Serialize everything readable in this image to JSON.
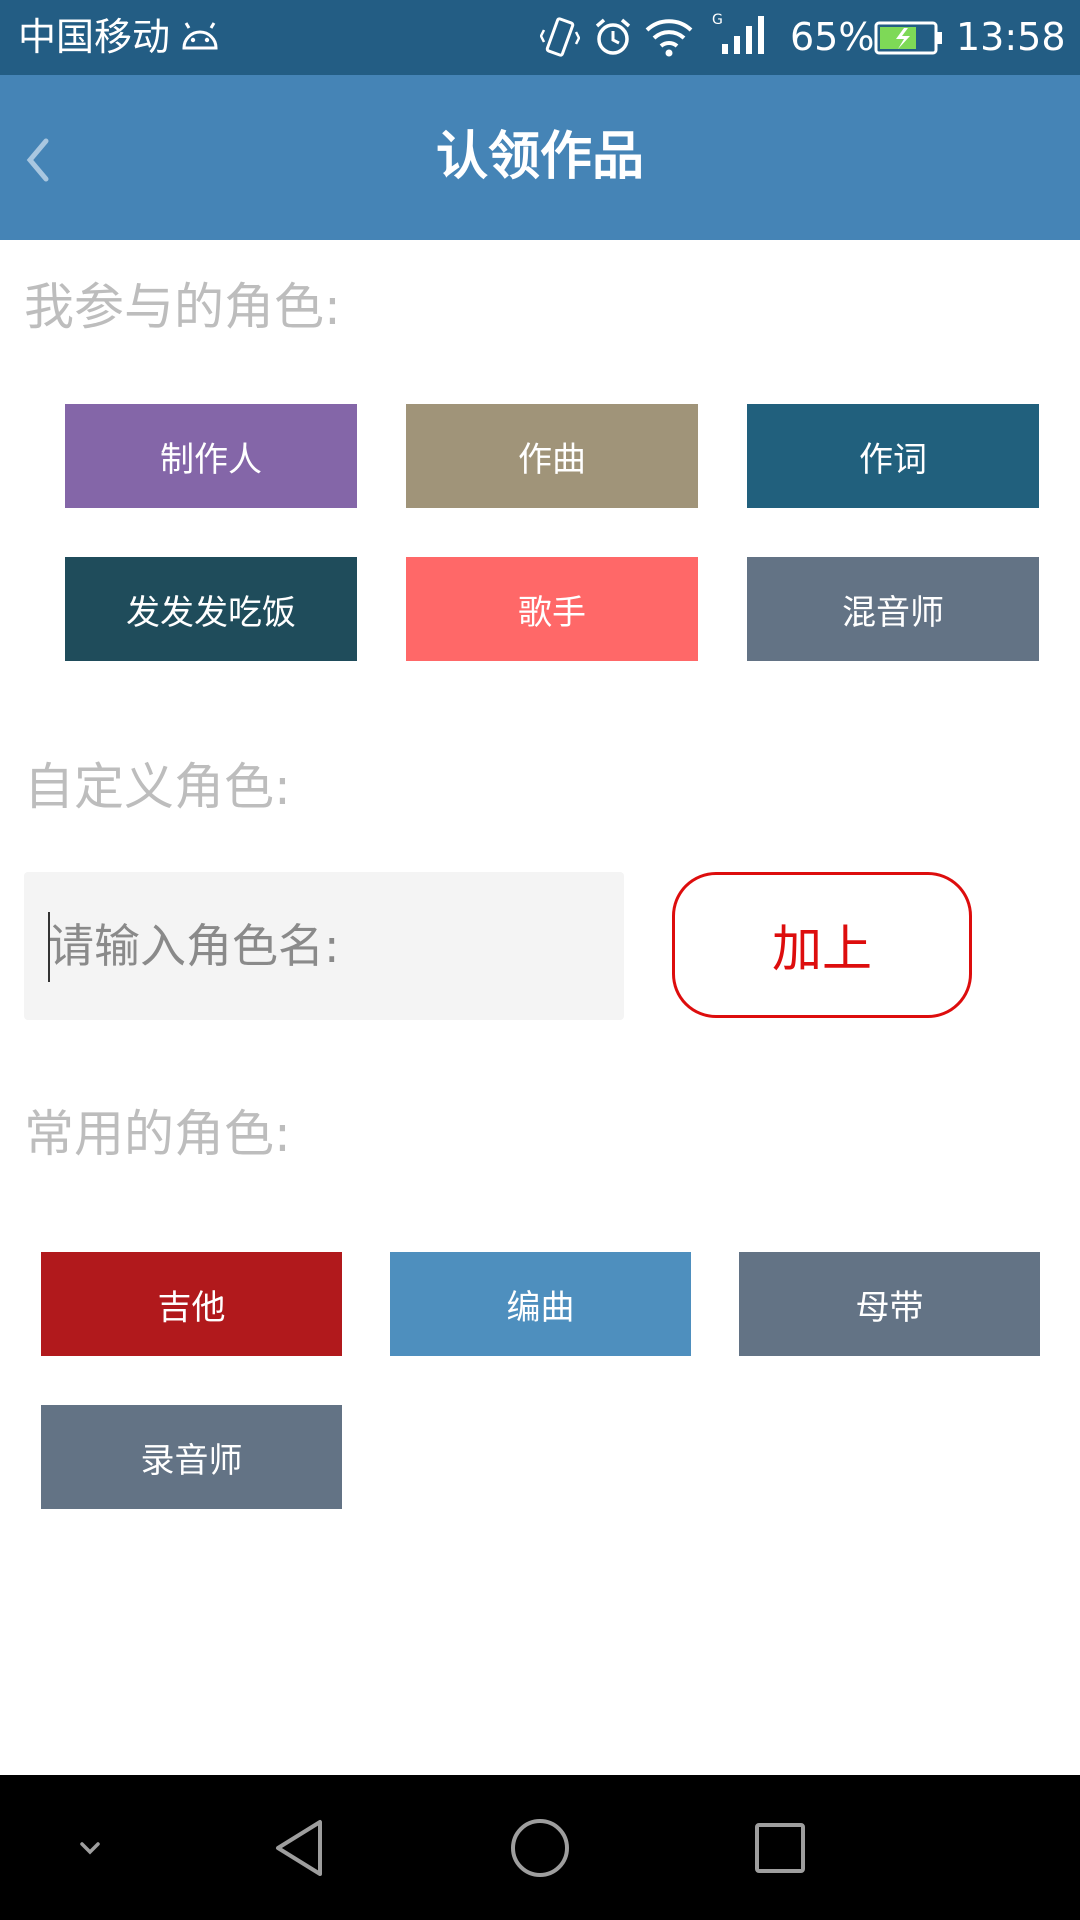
{
  "status_bar": {
    "carrier": "中国移动",
    "network_type": "G",
    "battery": "65%",
    "time": "13:58"
  },
  "app_bar": {
    "title": "认领作品"
  },
  "my_roles": {
    "label": "我参与的角色:",
    "items": [
      {
        "label": "制作人",
        "color": "#8466a8"
      },
      {
        "label": "作曲",
        "color": "#a09479"
      },
      {
        "label": "作词",
        "color": "#21607d"
      },
      {
        "label": "发发发吃饭",
        "color": "#1f4c5b"
      },
      {
        "label": "歌手",
        "color": "#ff6868"
      },
      {
        "label": "混音师",
        "color": "#637385"
      }
    ]
  },
  "custom_role": {
    "label": "自定义角色:",
    "placeholder": "请输入角色名:",
    "add_label": "加上",
    "accent": "#dd0d0d"
  },
  "common_roles": {
    "label": "常用的角色:",
    "items": [
      {
        "label": "吉他",
        "color": "#b1191c"
      },
      {
        "label": "编曲",
        "color": "#4e8fbe"
      },
      {
        "label": "母带",
        "color": "#637385"
      },
      {
        "label": "录音师",
        "color": "#637385"
      }
    ]
  },
  "colors": {
    "status_bar": "#235d84",
    "app_bar": "#4584b6",
    "section_label": "#bdbdbd"
  },
  "nav_bar": {
    "icons": [
      "chevron-down-icon",
      "back-triangle-icon",
      "home-circle-icon",
      "recents-square-icon"
    ]
  }
}
